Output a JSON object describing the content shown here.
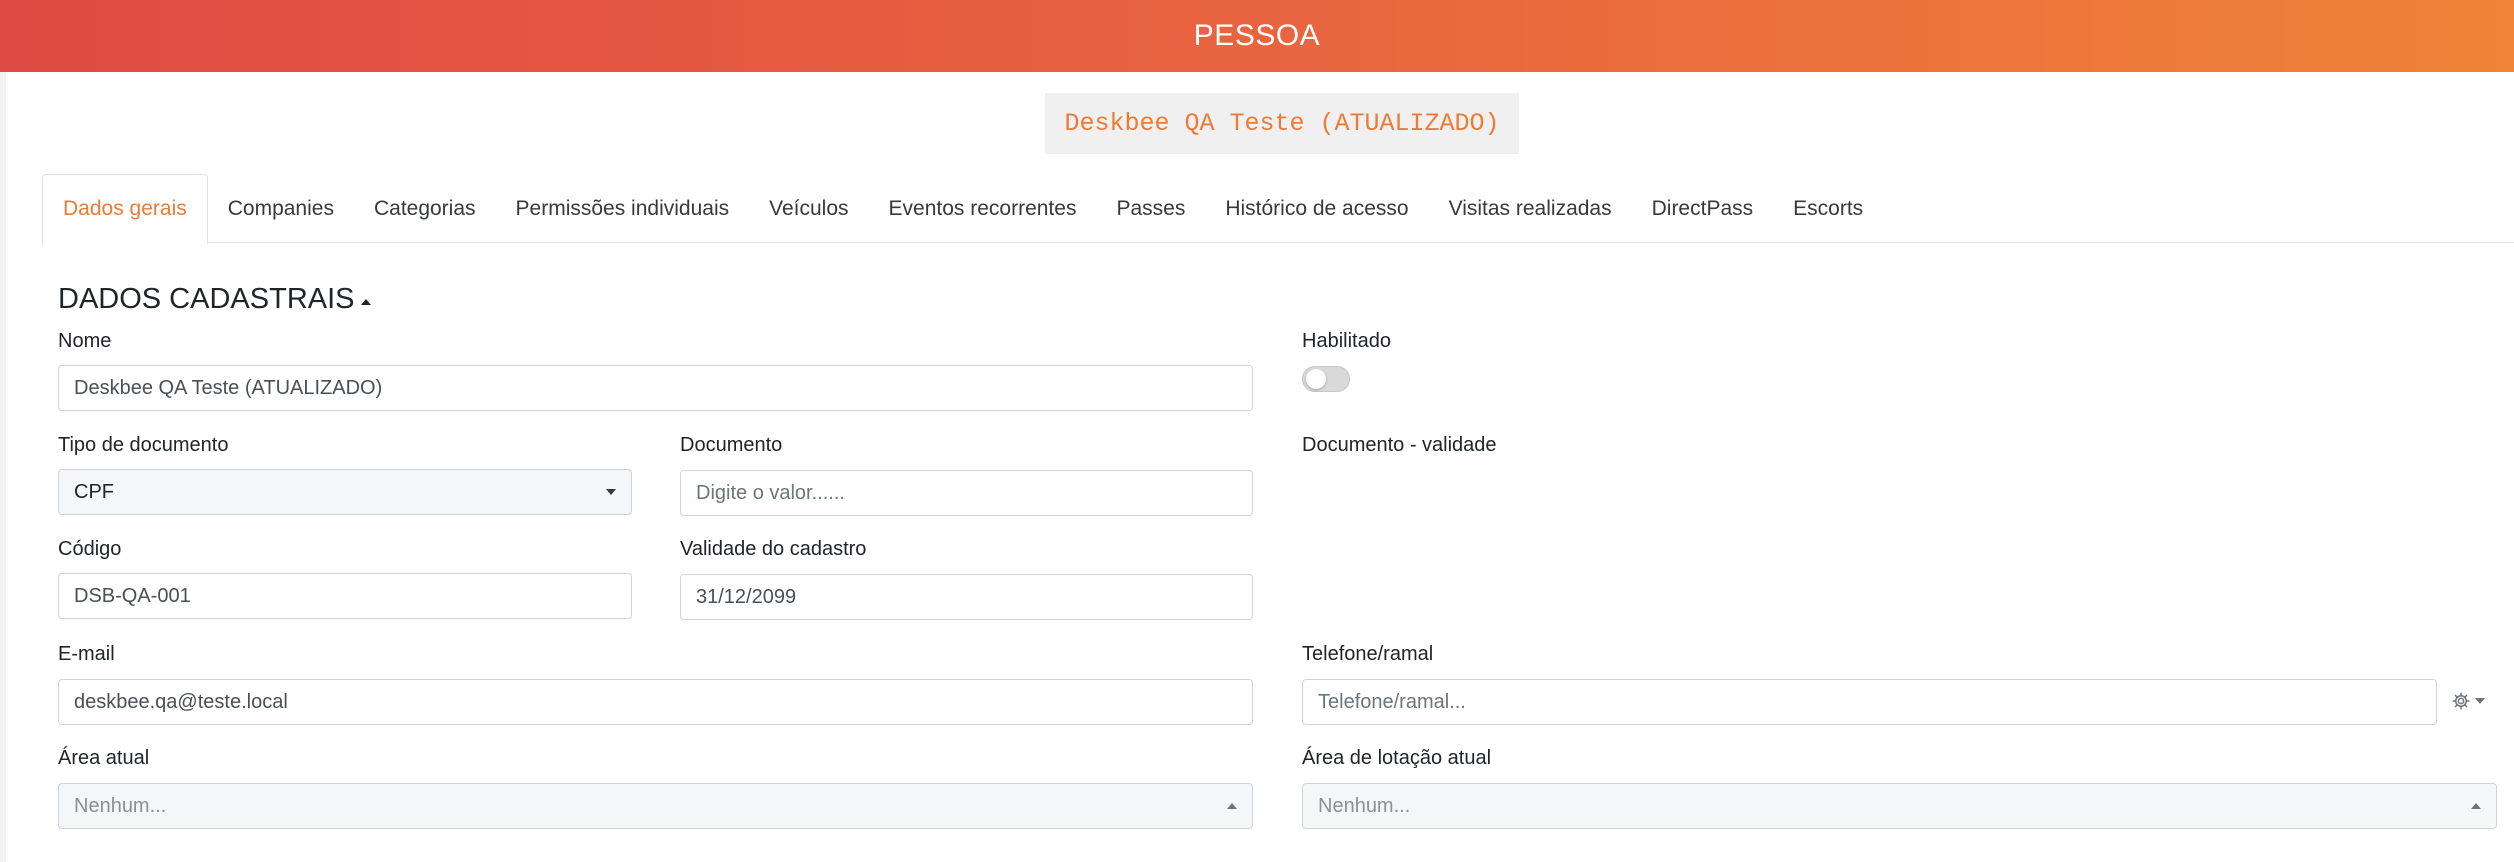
{
  "header": {
    "title": "PESSOA"
  },
  "person": {
    "display_name": "Deskbee QA Teste (ATUALIZADO)"
  },
  "tabs": [
    {
      "label": "Dados gerais",
      "active": true
    },
    {
      "label": "Companies"
    },
    {
      "label": "Categorias"
    },
    {
      "label": "Permissões individuais"
    },
    {
      "label": "Veículos"
    },
    {
      "label": "Eventos recorrentes"
    },
    {
      "label": "Passes"
    },
    {
      "label": "Histórico de acesso"
    },
    {
      "label": "Visitas realizadas"
    },
    {
      "label": "DirectPass"
    },
    {
      "label": "Escorts"
    }
  ],
  "section": {
    "title": "DADOS CADASTRAIS"
  },
  "form": {
    "nome": {
      "label": "Nome",
      "value": "Deskbee QA Teste (ATUALIZADO)"
    },
    "habilitado": {
      "label": "Habilitado",
      "enabled": false
    },
    "tipo_documento": {
      "label": "Tipo de documento",
      "value": "CPF"
    },
    "documento": {
      "label": "Documento",
      "placeholder": "Digite o valor......"
    },
    "documento_validade": {
      "label": "Documento - validade"
    },
    "codigo": {
      "label": "Código",
      "value": "DSB-QA-001"
    },
    "validade_cadastro": {
      "label": "Validade do cadastro",
      "value": "31/12/2099"
    },
    "email": {
      "label": "E-mail",
      "value": "deskbee.qa@teste.local"
    },
    "telefone": {
      "label": "Telefone/ramal",
      "placeholder": "Telefone/ramal..."
    },
    "area_atual": {
      "label": "Área atual",
      "placeholder": "Nenhum..."
    },
    "area_lotacao": {
      "label": "Área de lotação atual",
      "placeholder": "Nenhum..."
    }
  },
  "colors": {
    "accent": "#ee7b35",
    "header_start": "#e04a44",
    "header_end": "#f08338"
  },
  "icons": {
    "settings": "gear-icon",
    "dropdown": "chevron-down-icon",
    "collapse": "caret-up-icon"
  }
}
